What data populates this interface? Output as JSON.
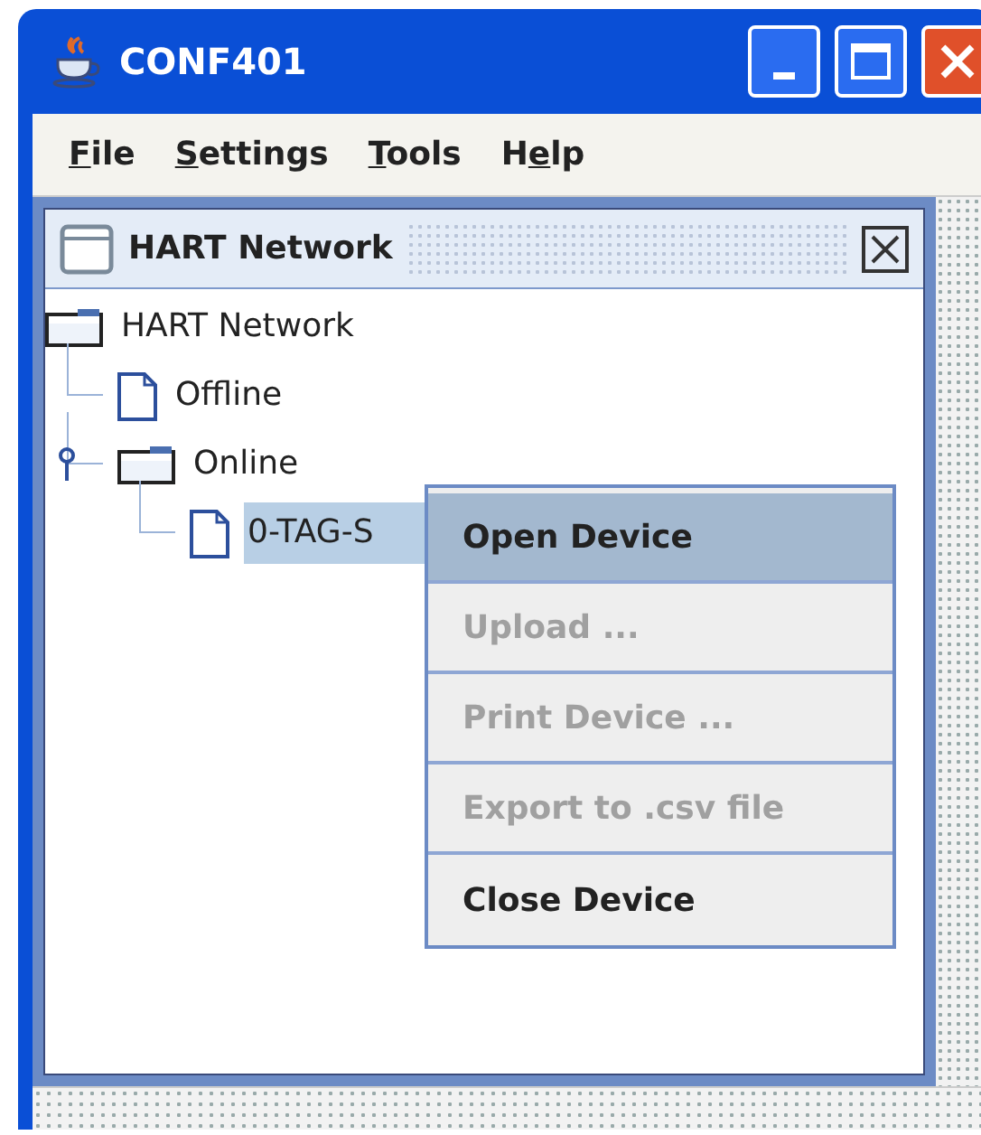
{
  "window": {
    "title": "CONF401"
  },
  "menu": [
    {
      "mnemonic": "F",
      "after": "ile"
    },
    {
      "mnemonic": "S",
      "after": "ettings"
    },
    {
      "mnemonic": "T",
      "after": "ools"
    },
    {
      "before": "H",
      "mnemonic": "e",
      "after": "lp"
    }
  ],
  "internal_frame": {
    "title": "HART Network"
  },
  "tree": [
    {
      "label": "HART Network",
      "kind": "folder",
      "selected": false,
      "children": [
        {
          "label": "Offline",
          "kind": "file",
          "selected": false
        },
        {
          "label": "Online",
          "kind": "folder",
          "selected": false,
          "expanded": true,
          "children": [
            {
              "label": "0-TAG-S",
              "kind": "file",
              "selected": true
            }
          ]
        }
      ]
    }
  ],
  "context_menu": [
    {
      "label": "Open Device",
      "selected": true,
      "disabled": false
    },
    {
      "label": "Upload ...",
      "selected": false,
      "disabled": true
    },
    {
      "label": "Print Device ...",
      "selected": false,
      "disabled": true
    },
    {
      "label": "Export to .csv file",
      "selected": false,
      "disabled": true
    },
    {
      "label": "Close Device",
      "selected": false,
      "disabled": false
    }
  ]
}
